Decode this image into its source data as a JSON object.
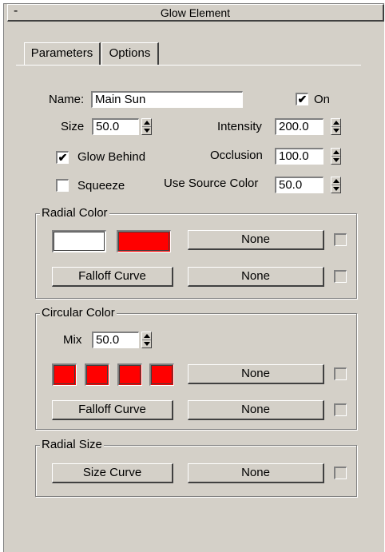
{
  "title": "Glow Element",
  "collapse_symbol": "-",
  "tabs": [
    {
      "label": "Parameters",
      "active": true
    },
    {
      "label": "Options",
      "active": false
    }
  ],
  "params": {
    "name_label": "Name:",
    "name_value": "Main Sun",
    "on_label": "On",
    "on_checked": true,
    "size_label": "Size",
    "size_value": "50.0",
    "intensity_label": "Intensity",
    "intensity_value": "200.0",
    "glow_behind_label": "Glow Behind",
    "glow_behind_checked": true,
    "occlusion_label": "Occlusion",
    "occlusion_value": "100.0",
    "squeeze_label": "Squeeze",
    "squeeze_checked": false,
    "use_source_color_label": "Use Source Color",
    "use_source_color_value": "50.0"
  },
  "radial_color": {
    "title": "Radial Color",
    "swatches": [
      "#ffffff",
      "#ff0000"
    ],
    "map_label": "None",
    "falloff_label": "Falloff Curve",
    "falloff_map_label": "None"
  },
  "circular_color": {
    "title": "Circular Color",
    "mix_label": "Mix",
    "mix_value": "50.0",
    "swatches": [
      "#ff0000",
      "#ff0000",
      "#ff0000",
      "#ff0000"
    ],
    "map_label": "None",
    "falloff_label": "Falloff Curve",
    "falloff_map_label": "None"
  },
  "radial_size": {
    "title": "Radial Size",
    "size_curve_label": "Size Curve",
    "map_label": "None"
  },
  "check_mark": "✔"
}
